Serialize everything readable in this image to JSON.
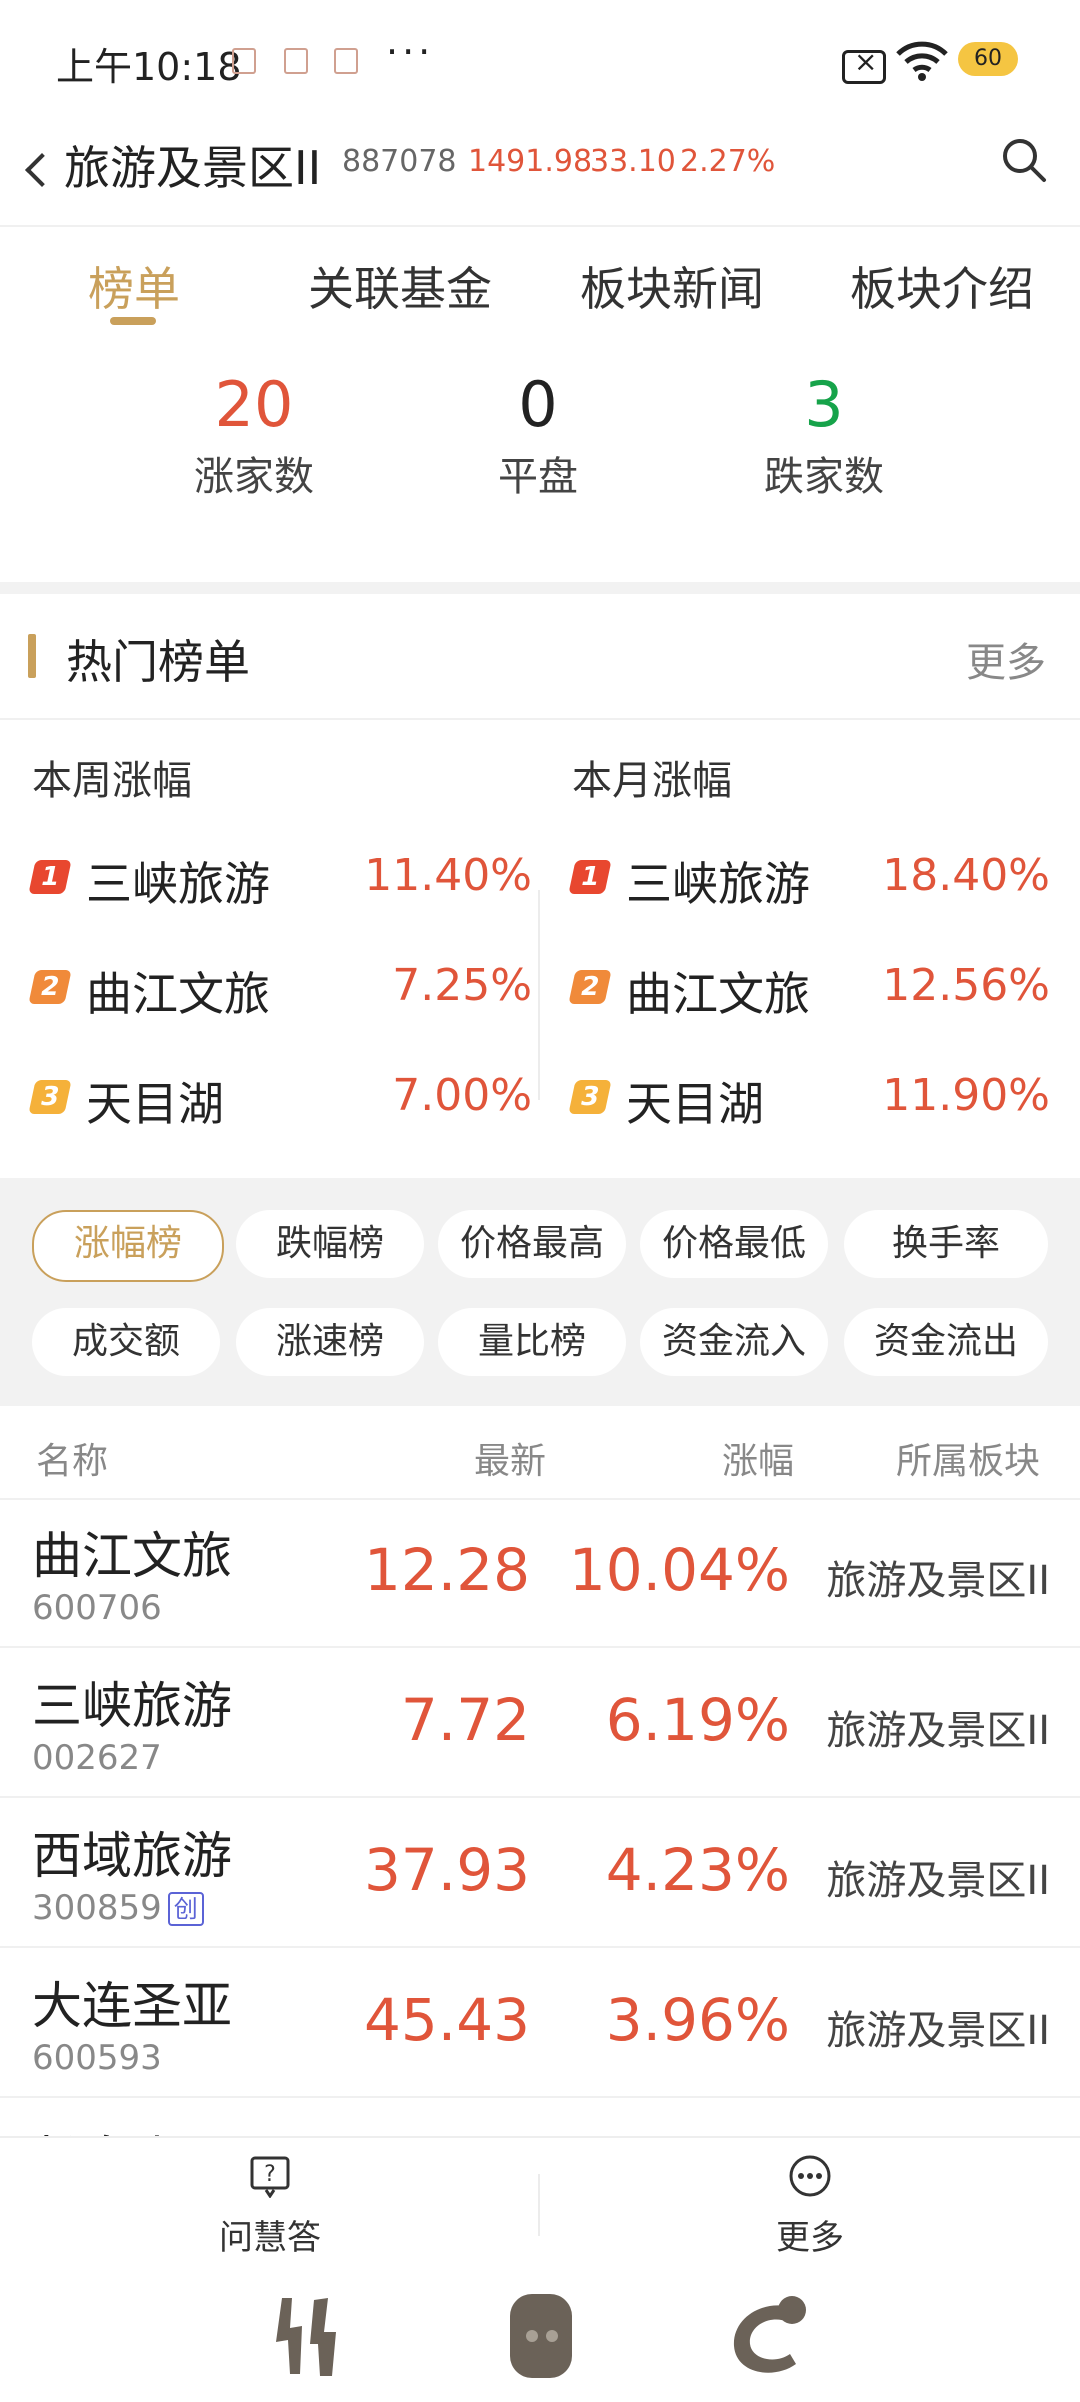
{
  "status_bar": {
    "time": "上午10:18",
    "dots": "···",
    "battery": "60"
  },
  "header": {
    "title": "旅游及景区II",
    "code": "887078",
    "price": "1491.98",
    "change": "33.10",
    "change_pct": "2.27%"
  },
  "tabs": [
    "榜单",
    "关联基金",
    "板块新闻",
    "板块介绍"
  ],
  "stats": {
    "up": {
      "count": "20",
      "label": "涨家数"
    },
    "flat": {
      "count": "0",
      "label": "平盘"
    },
    "down": {
      "count": "3",
      "label": "跌家数"
    }
  },
  "hot_list": {
    "title": "热门榜单",
    "more": "更多",
    "week": {
      "header": "本周涨幅",
      "items": [
        {
          "rank": "1",
          "name": "三峡旅游",
          "value": "11.40%"
        },
        {
          "rank": "2",
          "name": "曲江文旅",
          "value": "7.25%"
        },
        {
          "rank": "3",
          "name": "天目湖",
          "value": "7.00%"
        }
      ]
    },
    "month": {
      "header": "本月涨幅",
      "items": [
        {
          "rank": "1",
          "name": "三峡旅游",
          "value": "18.40%"
        },
        {
          "rank": "2",
          "name": "曲江文旅",
          "value": "12.56%"
        },
        {
          "rank": "3",
          "name": "天目湖",
          "value": "11.90%"
        }
      ]
    }
  },
  "chips": [
    "涨幅榜",
    "跌幅榜",
    "价格最高",
    "价格最低",
    "换手率",
    "成交额",
    "涨速榜",
    "量比榜",
    "资金流入",
    "资金流出"
  ],
  "table": {
    "headers": {
      "name": "名称",
      "latest": "最新",
      "pct": "涨幅",
      "sector": "所属板块"
    },
    "rows": [
      {
        "name": "曲江文旅",
        "code": "600706",
        "tag": "",
        "latest": "12.28",
        "pct": "10.04%",
        "sector": "旅游及景区II"
      },
      {
        "name": "三峡旅游",
        "code": "002627",
        "tag": "",
        "latest": "7.72",
        "pct": "6.19%",
        "sector": "旅游及景区II"
      },
      {
        "name": "西域旅游",
        "code": "300859",
        "tag": "创",
        "latest": "37.93",
        "pct": "4.23%",
        "sector": "旅游及景区II"
      },
      {
        "name": "大连圣亚",
        "code": "600593",
        "tag": "",
        "latest": "45.43",
        "pct": "3.96%",
        "sector": "旅游及景区II"
      }
    ],
    "partial_row_name": "长白山"
  },
  "bottom_bar": {
    "ask": "问慧答",
    "more": "更多"
  },
  "colors": {
    "accent": "#c9a05b",
    "up": "#e0553a",
    "down": "#16a34a",
    "rank1": "#e8472f",
    "rank2": "#f08a3a",
    "rank3": "#f5b13a"
  }
}
